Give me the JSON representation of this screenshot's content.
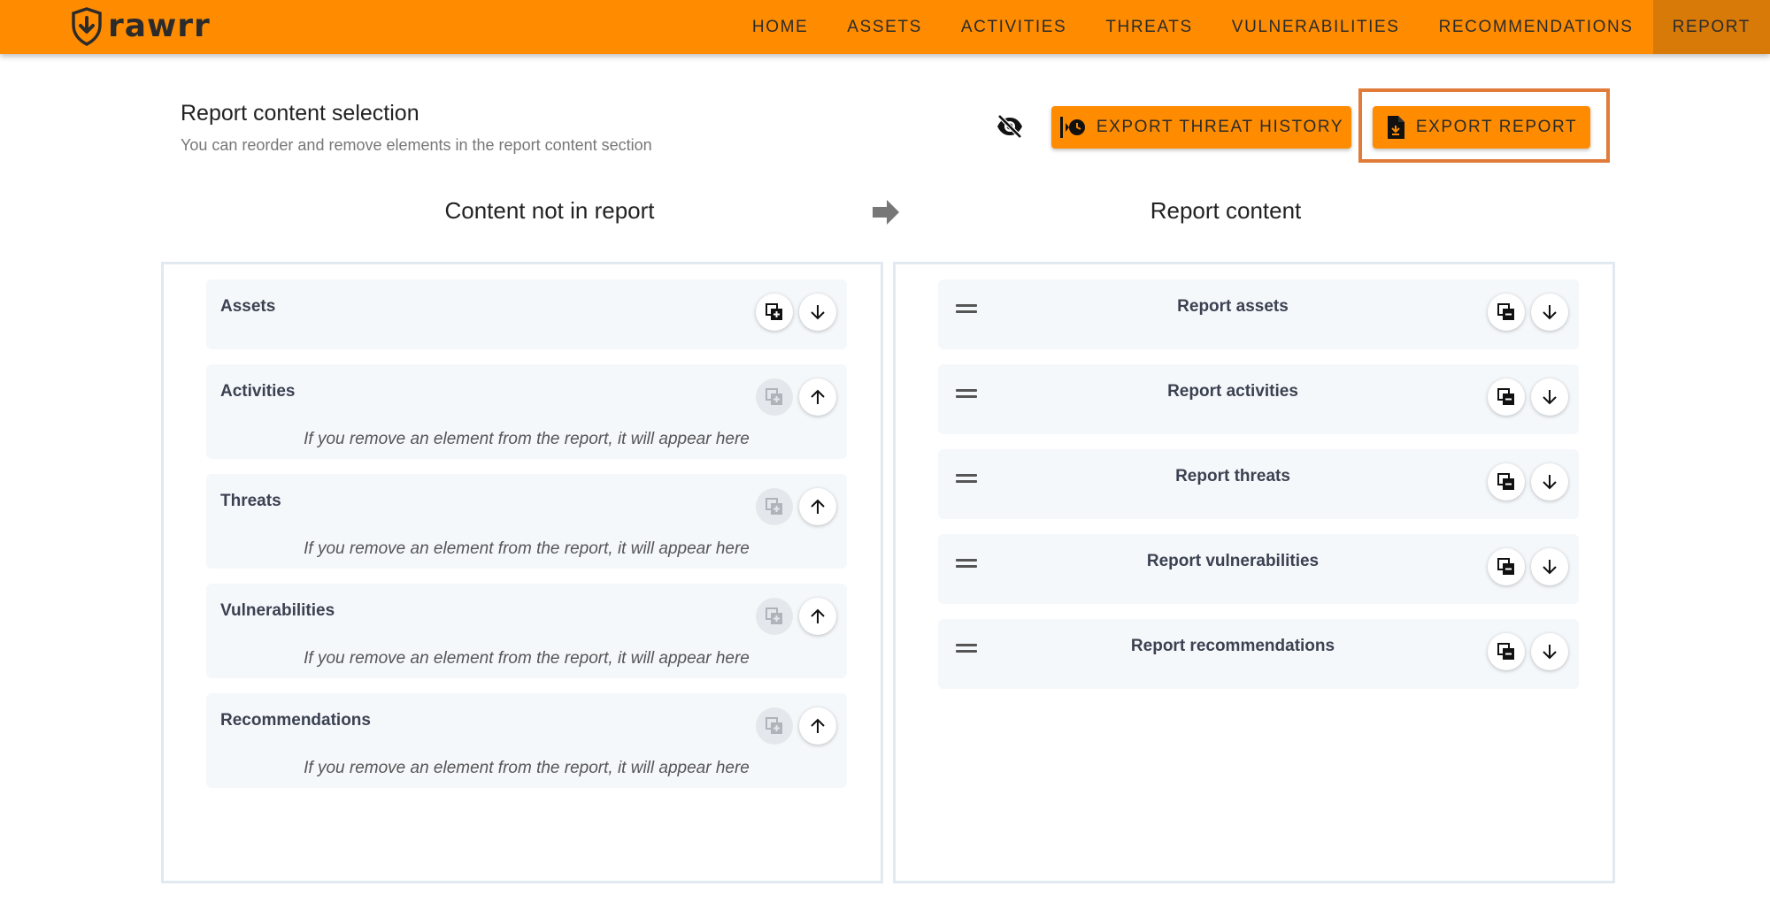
{
  "app": {
    "name": "rawrr",
    "brand_color": "#ff8c00"
  },
  "nav": {
    "items": [
      {
        "label": "HOME"
      },
      {
        "label": "ASSETS"
      },
      {
        "label": "ACTIVITIES"
      },
      {
        "label": "THREATS"
      },
      {
        "label": "VULNERABILITIES"
      },
      {
        "label": "RECOMMENDATIONS"
      },
      {
        "label": "REPORT",
        "active": true
      }
    ]
  },
  "header": {
    "title": "Report content selection",
    "subtitle": "You can reorder and remove elements in the report content section",
    "visibility_icon": "eye-off-icon",
    "export_history_label": "EXPORT THREAT HISTORY",
    "export_report_label": "EXPORT REPORT"
  },
  "columns": {
    "left_title": "Content not in report",
    "right_title": "Report content"
  },
  "not_in_report": [
    {
      "title": "Assets",
      "hint": "",
      "duplicate_enabled": true,
      "move": "down"
    },
    {
      "title": "Activities",
      "hint": "If you remove an element from the report, it will appear here",
      "duplicate_enabled": false,
      "move": "up"
    },
    {
      "title": "Threats",
      "hint": "If you remove an element from the report, it will appear here",
      "duplicate_enabled": false,
      "move": "up"
    },
    {
      "title": "Vulnerabilities",
      "hint": "If you remove an element from the report, it will appear here",
      "duplicate_enabled": false,
      "move": "up"
    },
    {
      "title": "Recommendations",
      "hint": "If you remove an element from the report, it will appear here",
      "duplicate_enabled": false,
      "move": "up"
    }
  ],
  "report_content": [
    {
      "title": "Report assets"
    },
    {
      "title": "Report activities"
    },
    {
      "title": "Report threats"
    },
    {
      "title": "Report vulnerabilities"
    },
    {
      "title": "Report recommendations"
    }
  ]
}
